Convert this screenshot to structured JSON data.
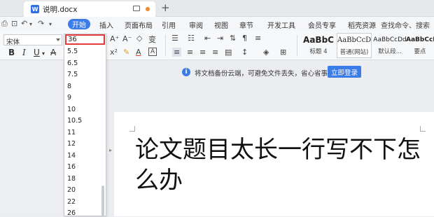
{
  "tab": {
    "title": "说明.docx",
    "doc_icon": "W",
    "new_tab": "+"
  },
  "menu": {
    "home_label": "开始",
    "items": [
      "插入",
      "页面布局",
      "引用",
      "审阅",
      "视图",
      "章节",
      "开发工具",
      "会员专享",
      "稻壳资源"
    ],
    "search_hint": "查找命令、搜索"
  },
  "ribbon": {
    "font_name": "宋体",
    "bold": "B",
    "italic": "I",
    "underline": "U",
    "strike": "A",
    "grow_font": "A⁺",
    "shrink_font": "A⁻",
    "clear_format": "◇",
    "phonetic": "变",
    "font_color": "A",
    "char_border": "A",
    "styles": [
      {
        "sample": "AaBbC",
        "label": "标题 4"
      },
      {
        "sample": "AaBbCcDc",
        "label": "普通(网站)"
      },
      {
        "sample": "AaBbCcDd",
        "label": "默认段..."
      },
      {
        "sample": "AaBbCcDd",
        "label": "要点"
      }
    ]
  },
  "notice": {
    "text": "将文档备份云端，可避免文件丢失，省心省事",
    "login_button": "立即登录"
  },
  "font_size_dropdown": {
    "current": "36",
    "options": [
      "5.5",
      "6.5",
      "7.5",
      "8",
      "9",
      "10",
      "10.5",
      "11",
      "12",
      "14",
      "16",
      "18",
      "20",
      "22",
      "26"
    ]
  },
  "document": {
    "text": "论文题目太长一行写不下怎么办"
  },
  "icons": {
    "info": "i",
    "accent": "#3b7ce8",
    "highlight_border": "#e23b3b"
  }
}
